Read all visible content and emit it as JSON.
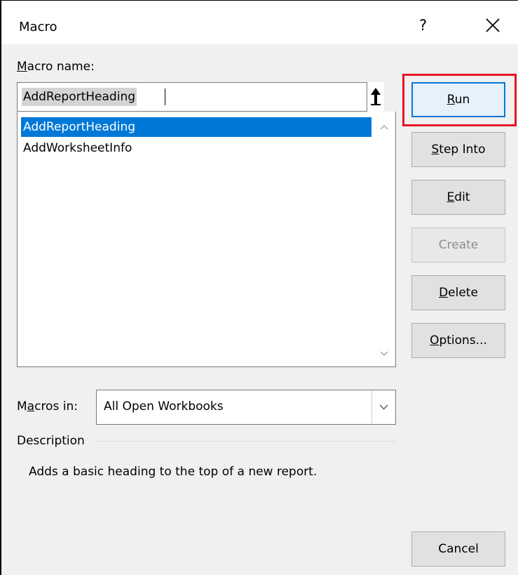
{
  "dialog": {
    "title": "Macro",
    "help_label": "?",
    "close_icon": "close-icon"
  },
  "macro_name": {
    "label_accel": "M",
    "label_rest": "acro name:",
    "value": "AddReportHeading"
  },
  "macro_list": {
    "items": [
      {
        "label": "AddReportHeading",
        "selected": true
      },
      {
        "label": "AddWorksheetInfo",
        "selected": false
      }
    ]
  },
  "buttons": {
    "run": {
      "accel": "R",
      "rest": "un"
    },
    "step_into": {
      "accel": "S",
      "rest": "tep Into"
    },
    "edit": {
      "accel": "E",
      "rest": "dit"
    },
    "create": {
      "label": "Create"
    },
    "delete": {
      "accel": "D",
      "rest": "elete"
    },
    "options": {
      "accel": "O",
      "rest": "ptions..."
    },
    "cancel": {
      "label": "Cancel"
    }
  },
  "macros_in": {
    "label_pre": "M",
    "label_accel": "a",
    "label_post": "cros in:",
    "value": "All Open Workbooks"
  },
  "description": {
    "label": "Description",
    "text": "Adds a basic heading to the top of a new report."
  },
  "colors": {
    "selection": "#0078d7",
    "highlight_border": "#e81123"
  }
}
